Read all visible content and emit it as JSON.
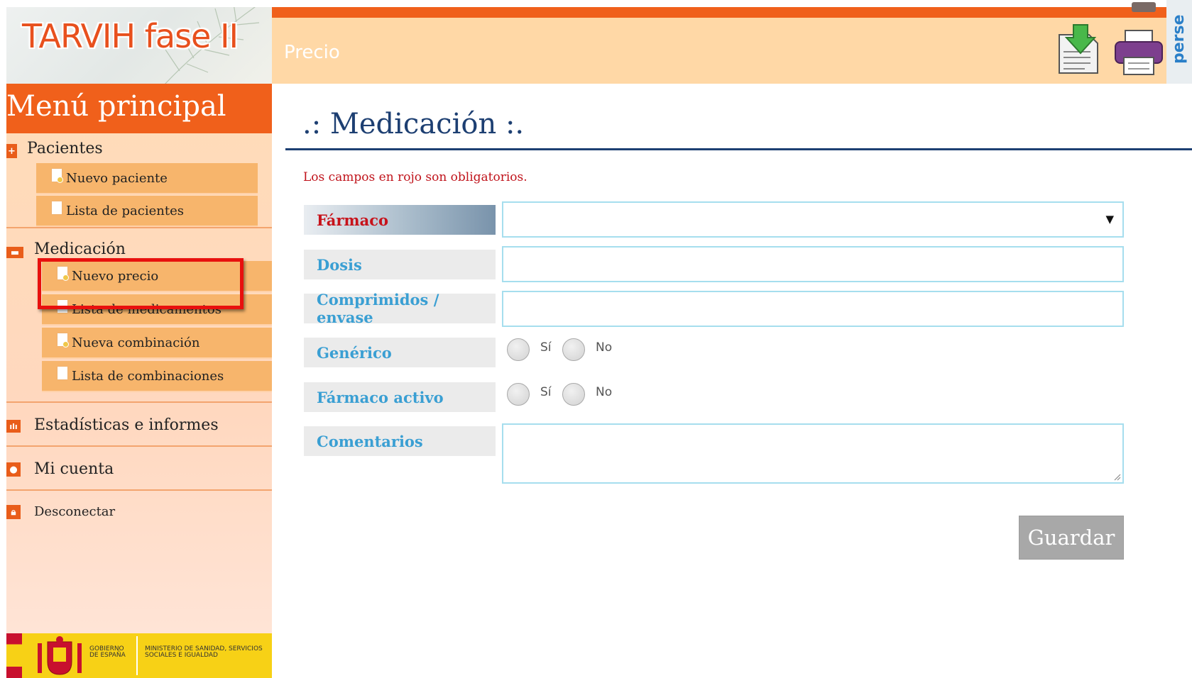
{
  "app": {
    "logo_text": "TARVIH fase II",
    "brand_side_text": "perse"
  },
  "header": {
    "title": "Precio",
    "export_icon": "download-document-icon",
    "print_icon": "printer-icon"
  },
  "sidebar": {
    "title": "Menú principal",
    "sections": [
      {
        "label": "Pacientes",
        "icon": "plus-icon",
        "items": [
          {
            "label": "Nuevo paciente",
            "icon": "new-document-icon"
          },
          {
            "label": "Lista de pacientes",
            "icon": "document-icon"
          }
        ]
      },
      {
        "label": "Medicación",
        "icon": "pill-icon",
        "items": [
          {
            "label": "Nuevo precio",
            "icon": "new-document-icon",
            "highlighted": true
          },
          {
            "label": "Lista de medicamentos",
            "icon": "document-icon"
          },
          {
            "label": "Nueva combinación",
            "icon": "new-document-icon"
          },
          {
            "label": "Lista de combinaciones",
            "icon": "document-icon"
          }
        ]
      },
      {
        "label": "Estadísticas e informes",
        "icon": "bar-chart-icon"
      },
      {
        "label": "Mi cuenta",
        "icon": "user-icon"
      },
      {
        "label": "Desconectar",
        "icon": "lock-icon"
      }
    ]
  },
  "footer": {
    "gov_line1": "GOBIERNO DE ESPAÑA",
    "gov_line2": "MINISTERIO DE SANIDAD, SERVICIOS SOCIALES E IGUALDAD"
  },
  "main": {
    "title": ".: Medicación :.",
    "required_note": "Los campos en rojo son obligatorios.",
    "fields": {
      "farmaco": {
        "label": "Fármaco",
        "value": "",
        "required": true
      },
      "dosis": {
        "label": "Dosis",
        "value": ""
      },
      "comprimidos": {
        "label": "Comprimidos / envase",
        "value": ""
      },
      "generico": {
        "label": "Genérico",
        "options": [
          "Sí",
          "No"
        ],
        "selected": null
      },
      "activo": {
        "label": "Fármaco activo",
        "options": [
          "Sí",
          "No"
        ],
        "selected": null
      },
      "comentarios": {
        "label": "Comentarios",
        "value": ""
      }
    },
    "save_label": "Guardar"
  },
  "colors": {
    "accent": "#f0601b",
    "header_bg": "#ffd8a6",
    "title": "#1d3f72",
    "field_label": "#3a9fd3",
    "required": "#c7131b"
  }
}
